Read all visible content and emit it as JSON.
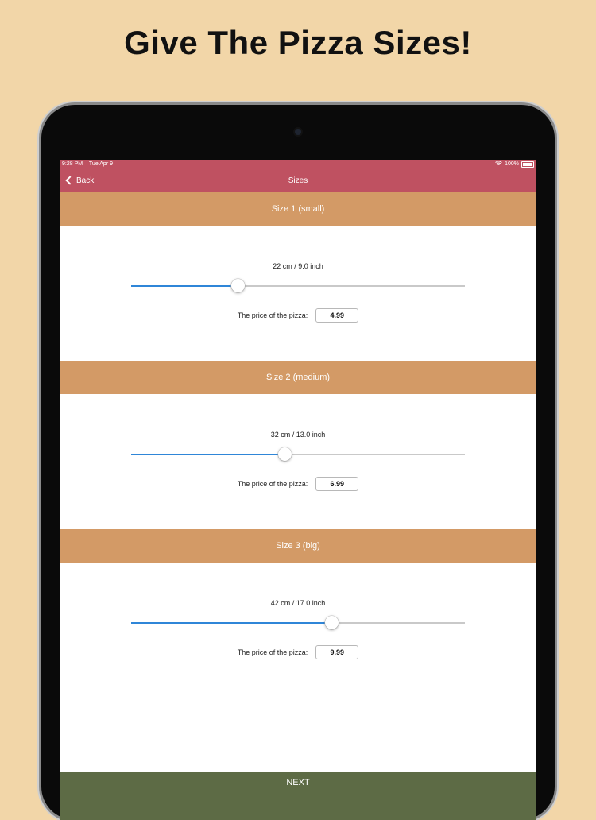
{
  "headline": "Give The Pizza Sizes!",
  "status": {
    "time": "9:28 PM",
    "date": "Tue Apr 9",
    "battery": "100%"
  },
  "nav": {
    "back_label": "Back",
    "title": "Sizes"
  },
  "sizes": [
    {
      "header": "Size 1 (small)",
      "label": "22 cm / 9.0 inch",
      "slider_fraction": 0.32,
      "price_label": "The price of the pizza:",
      "price": "4.99"
    },
    {
      "header": "Size 2 (medium)",
      "label": "32 cm / 13.0 inch",
      "slider_fraction": 0.46,
      "price_label": "The price of the pizza:",
      "price": "6.99"
    },
    {
      "header": "Size 3 (big)",
      "label": "42 cm / 17.0 inch",
      "slider_fraction": 0.6,
      "price_label": "The price of the pizza:",
      "price": "9.99"
    }
  ],
  "next_label": "NEXT",
  "colors": {
    "background": "#f2d6a8",
    "navbar": "#bf5161",
    "section_header": "#d39a66",
    "next_bar": "#5d6b45",
    "slider_fill": "#2f86d8"
  }
}
